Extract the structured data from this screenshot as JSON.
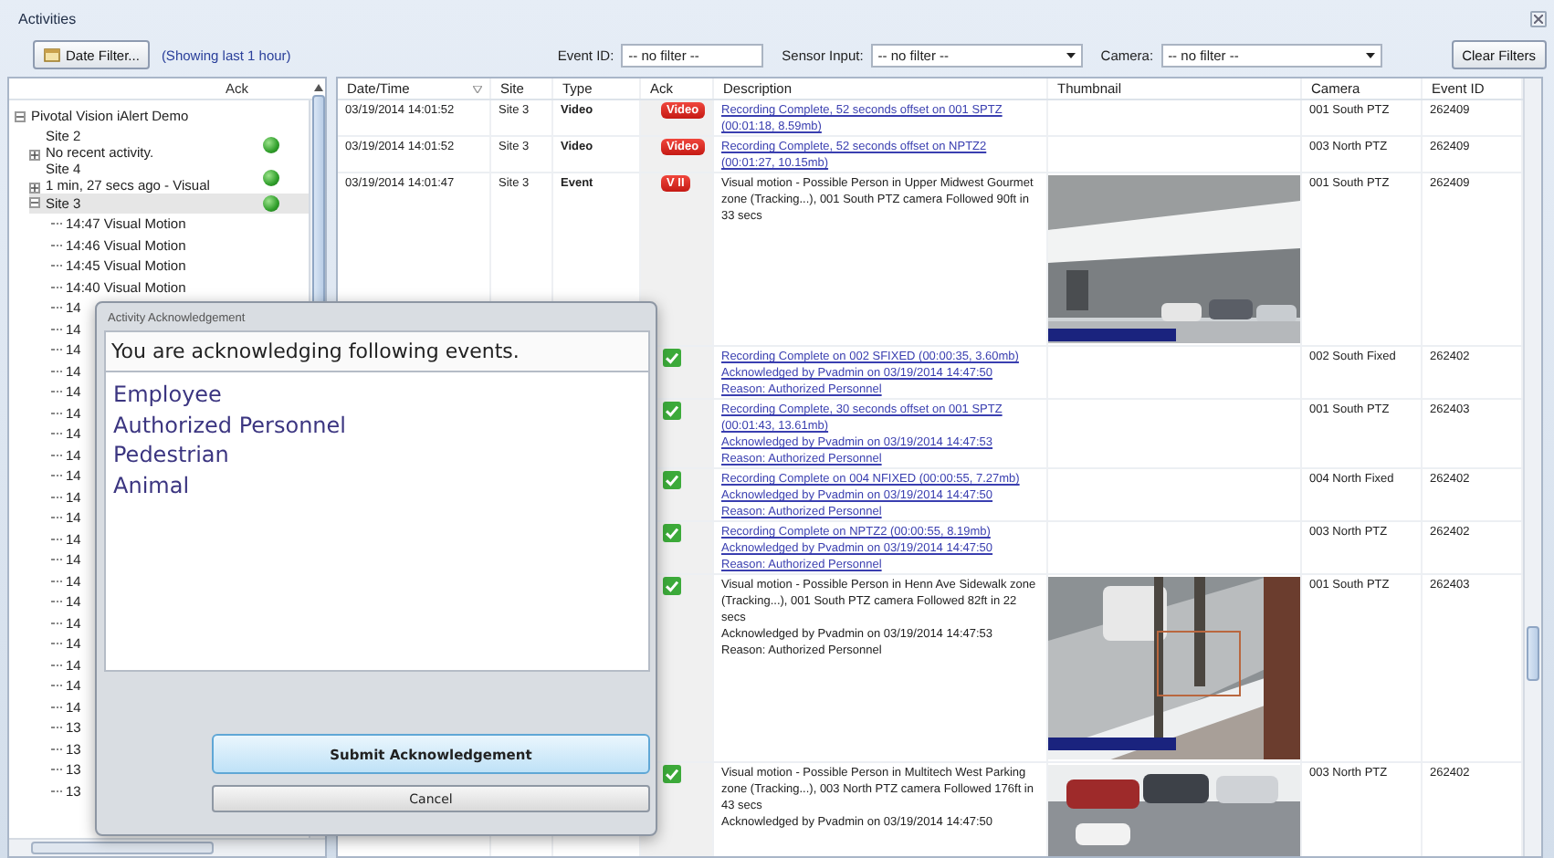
{
  "window": {
    "title": "Activities"
  },
  "toolbar": {
    "date_filter_button": "Date Filter...",
    "date_range": "(Showing last 1 hour)",
    "event_id": {
      "label": "Event ID:",
      "value": "-- no filter --"
    },
    "sensor_input": {
      "label": "Sensor Input:",
      "value": "-- no filter --"
    },
    "camera": {
      "label": "Camera:",
      "value": "-- no filter --"
    },
    "clear_button": "Clear Filters"
  },
  "tree": {
    "header": "Ack",
    "nodes": [
      {
        "label": "Pivotal Vision iAlert Demo",
        "expanded": true,
        "selected": false,
        "children": [
          {
            "label": "Site 2",
            "status": "No recent activity.",
            "expanded": false,
            "selected": false
          },
          {
            "label": "Site 4",
            "status": "1 min, 27 secs ago - Visual",
            "expanded": false,
            "selected": false
          },
          {
            "label": "Site 3",
            "expanded": true,
            "selected": true,
            "children": [
              {
                "label": "14:47 Visual Motion",
                "selected": false
              },
              {
                "label": "14:46 Visual Motion",
                "selected": false
              },
              {
                "label": "14:45 Visual Motion",
                "selected": false
              },
              {
                "label": "14:40 Visual Motion",
                "selected": false
              },
              {
                "label": "14",
                "selected": false
              },
              {
                "label": "14",
                "selected": false
              },
              {
                "label": "14",
                "selected": false
              },
              {
                "label": "14",
                "selected": false
              },
              {
                "label": "14",
                "selected": false
              },
              {
                "label": "14",
                "selected": false
              },
              {
                "label": "14",
                "selected": false
              },
              {
                "label": "14",
                "selected": false
              },
              {
                "label": "14",
                "selected": false
              },
              {
                "label": "14",
                "selected": false
              },
              {
                "label": "14",
                "selected": false
              },
              {
                "label": "14",
                "selected": false
              },
              {
                "label": "14",
                "selected": false
              },
              {
                "label": "14",
                "selected": false
              },
              {
                "label": "14",
                "selected": false
              },
              {
                "label": "14",
                "selected": false
              },
              {
                "label": "14",
                "selected": false
              },
              {
                "label": "14",
                "selected": false
              },
              {
                "label": "14",
                "selected": false
              },
              {
                "label": "14",
                "selected": false
              },
              {
                "label": "13",
                "selected": false
              },
              {
                "label": "13",
                "selected": false
              },
              {
                "label": "13",
                "selected": false
              },
              {
                "label": "13",
                "selected": false
              }
            ]
          }
        ]
      }
    ]
  },
  "table": {
    "columns": [
      "Date/Time",
      "Site",
      "Type",
      "Ack",
      "Description",
      "Thumbnail",
      "Camera",
      "Event ID"
    ],
    "rows": [
      {
        "datetime": "03/19/2014 14:01:52",
        "site": "Site 3",
        "type": "Video",
        "ack": {
          "kind": "badge",
          "text": "Video"
        },
        "description": [
          {
            "text": "Recording Complete, 52 seconds offset on 001 SPTZ (00:01:18, 8.59mb)",
            "link": true
          }
        ],
        "camera": "001 South PTZ",
        "event_id": "262409"
      },
      {
        "datetime": "03/19/2014 14:01:52",
        "site": "Site 3",
        "type": "Video",
        "ack": {
          "kind": "badge",
          "text": "Video"
        },
        "description": [
          {
            "text": "Recording Complete, 52 seconds offset on NPTZ2 (00:01:27, 10.15mb)",
            "link": true
          }
        ],
        "camera": "003 North PTZ",
        "event_id": "262409"
      },
      {
        "datetime": "03/19/2014 14:01:47",
        "site": "Site 3",
        "type": "Event",
        "ack": {
          "kind": "badge",
          "text": "V II"
        },
        "description": [
          {
            "text": "Visual motion - Possible Person in Upper Midwest Gourmet zone (Tracking...), 001 South PTZ camera Followed 90ft in 33 secs",
            "link": false
          }
        ],
        "thumbnail": {
          "kind": "picture"
        },
        "camera": "001 South PTZ",
        "event_id": "262409"
      },
      {
        "ack": {
          "kind": "check"
        },
        "description": [
          {
            "text": "Recording Complete on 002 SFIXED (00:00:35, 3.60mb)",
            "link": true
          },
          {
            "text": "Acknowledged by Pvadmin on 03/19/2014 14:47:50",
            "link": true
          },
          {
            "text": "Reason: Authorized Personnel",
            "link": true
          }
        ],
        "camera": "002 South Fixed",
        "event_id": "262402"
      },
      {
        "ack": {
          "kind": "check"
        },
        "description": [
          {
            "text": "Recording Complete, 30 seconds offset on 001 SPTZ (00:01:43, 13.61mb)",
            "link": true
          },
          {
            "text": "Acknowledged by Pvadmin on 03/19/2014 14:47:53",
            "link": true
          },
          {
            "text": "Reason: Authorized Personnel",
            "link": true
          }
        ],
        "camera": "001 South PTZ",
        "event_id": "262403"
      },
      {
        "ack": {
          "kind": "check"
        },
        "description": [
          {
            "text": "Recording Complete on 004 NFIXED (00:00:55, 7.27mb)",
            "link": true
          },
          {
            "text": "Acknowledged by Pvadmin on 03/19/2014 14:47:50",
            "link": true
          },
          {
            "text": "Reason: Authorized Personnel",
            "link": true
          }
        ],
        "camera": "004 North Fixed",
        "event_id": "262402"
      },
      {
        "ack": {
          "kind": "check"
        },
        "description": [
          {
            "text": "Recording Complete on NPTZ2 (00:00:55, 8.19mb)",
            "link": true
          },
          {
            "text": "Acknowledged by Pvadmin on 03/19/2014 14:47:50",
            "link": true
          },
          {
            "text": "Reason: Authorized Personnel",
            "link": true
          }
        ],
        "camera": "003 North PTZ",
        "event_id": "262402"
      },
      {
        "ack": {
          "kind": "check"
        },
        "description": [
          {
            "text": "Visual motion - Possible Person in Henn Ave Sidewalk zone (Tracking...), 001 South PTZ camera Followed 82ft in 22 secs",
            "link": false
          },
          {
            "text": "Acknowledged by Pvadmin on 03/19/2014 14:47:53",
            "link": false
          },
          {
            "text": "Reason: Authorized Personnel",
            "link": false
          }
        ],
        "thumbnail": {
          "kind": "picture"
        },
        "camera": "001 South PTZ",
        "event_id": "262403"
      },
      {
        "ack": {
          "kind": "check"
        },
        "description": [
          {
            "text": "Visual motion - Possible Person in Multitech West Parking zone (Tracking...), 003 North PTZ camera Followed 176ft in 43 secs",
            "link": false
          },
          {
            "text": "Acknowledged by Pvadmin on 03/19/2014 14:47:50",
            "link": false
          }
        ],
        "thumbnail": {
          "kind": "picture"
        },
        "camera": "003 North PTZ",
        "event_id": "262402"
      }
    ]
  },
  "dialog": {
    "title": "Activity Acknowledgement",
    "heading": "You are acknowledging following events.",
    "reasons": [
      "Employee",
      "Authorized Personnel",
      "Pedestrian",
      "Animal"
    ],
    "submit_button": "Submit Acknowledgement",
    "cancel_button": "Cancel"
  }
}
